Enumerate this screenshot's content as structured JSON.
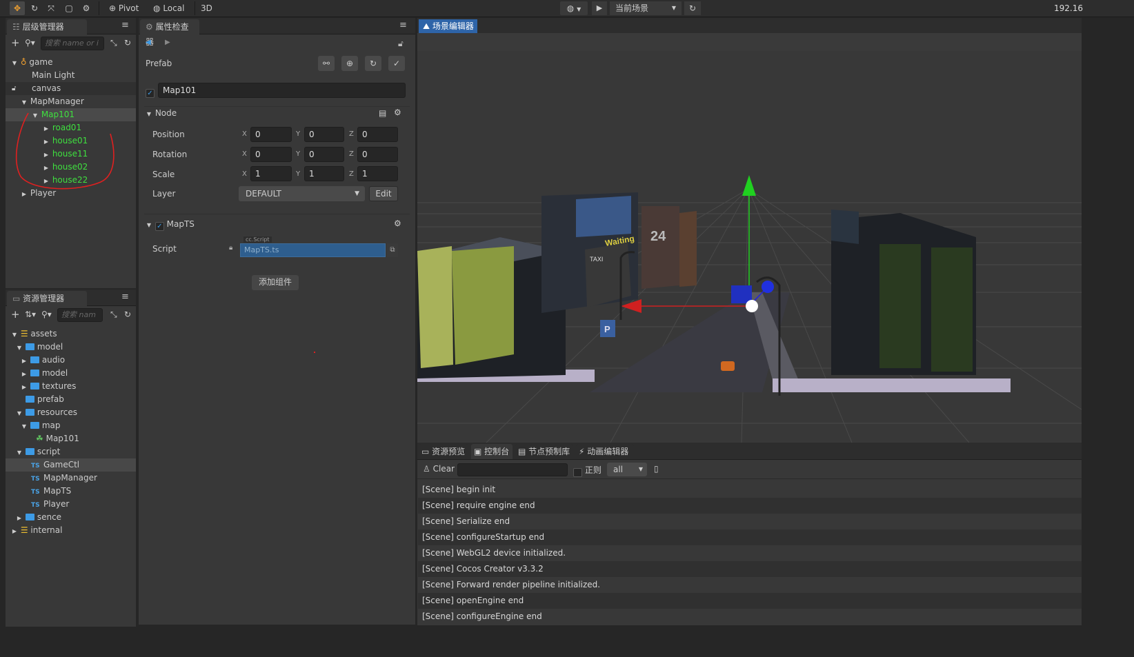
{
  "toolbar": {
    "pivot_label": "Pivot",
    "local_label": "Local",
    "mode_3d_label": "3D",
    "scene_select_label": "当前场景",
    "ip_text": "192.16"
  },
  "hierarchy": {
    "title": "层级管理器",
    "search_placeholder": "搜索 name or i",
    "nodes": [
      {
        "label": "game"
      },
      {
        "label": "Main Light"
      },
      {
        "label": "canvas"
      },
      {
        "label": "MapManager"
      },
      {
        "label": "Map101"
      },
      {
        "label": "road01"
      },
      {
        "label": "house01"
      },
      {
        "label": "house11"
      },
      {
        "label": "house02"
      },
      {
        "label": "house22"
      },
      {
        "label": "Player"
      }
    ]
  },
  "assets": {
    "title": "资源管理器",
    "search_placeholder": "搜索 nam",
    "items": [
      {
        "label": "assets"
      },
      {
        "label": "model"
      },
      {
        "label": "audio"
      },
      {
        "label": "model"
      },
      {
        "label": "textures"
      },
      {
        "label": "prefab"
      },
      {
        "label": "resources"
      },
      {
        "label": "map"
      },
      {
        "label": "Map101"
      },
      {
        "label": "script"
      },
      {
        "label": "GameCtl"
      },
      {
        "label": "MapManager"
      },
      {
        "label": "MapTS"
      },
      {
        "label": "Player"
      },
      {
        "label": "sence"
      },
      {
        "label": "internal"
      }
    ],
    "ts_badge": "TS"
  },
  "inspector": {
    "title": "属性检查器",
    "prefab_label": "Prefab",
    "node_name": "Map101",
    "node_section": "Node",
    "position_label": "Position",
    "rotation_label": "Rotation",
    "scale_label": "Scale",
    "layer_label": "Layer",
    "axis_x": "X",
    "axis_y": "Y",
    "axis_z": "Z",
    "position": {
      "x": "0",
      "y": "0",
      "z": "0"
    },
    "rotation": {
      "x": "0",
      "y": "0",
      "z": "0"
    },
    "scale": {
      "x": "1",
      "y": "1",
      "z": "1"
    },
    "layer_value": "DEFAULT",
    "edit_label": "Edit",
    "component_name": "MapTS",
    "script_label": "Script",
    "script_type": "cc.Script",
    "script_value": "MapTS.ts",
    "add_component_label": "添加组件"
  },
  "scene": {
    "tab_label": "场景编辑器",
    "sign_waiting": "Waiting",
    "sign_taxi": "TAXI",
    "sign_24": "24",
    "sign_parking": "P"
  },
  "console": {
    "tabs": [
      {
        "label": "资源预览"
      },
      {
        "label": "控制台"
      },
      {
        "label": "节点预制库"
      },
      {
        "label": "动画编辑器"
      }
    ],
    "clear_label": "Clear",
    "regex_label": "正则",
    "filter_value": "all",
    "logs": [
      "[Scene] begin init",
      "[Scene] require engine end",
      "[Scene] Serialize end",
      "[Scene] configureStartup end",
      "[Scene] WebGL2 device initialized.",
      "[Scene] Cocos Creator v3.3.2",
      "[Scene] Forward render pipeline initialized.",
      "[Scene] openEngine end",
      "[Scene] configureEngine end"
    ]
  },
  "colors": {
    "accent_blue": "#3d9be6",
    "node_green": "#3fe03f",
    "annotation_red": "#e02020"
  }
}
